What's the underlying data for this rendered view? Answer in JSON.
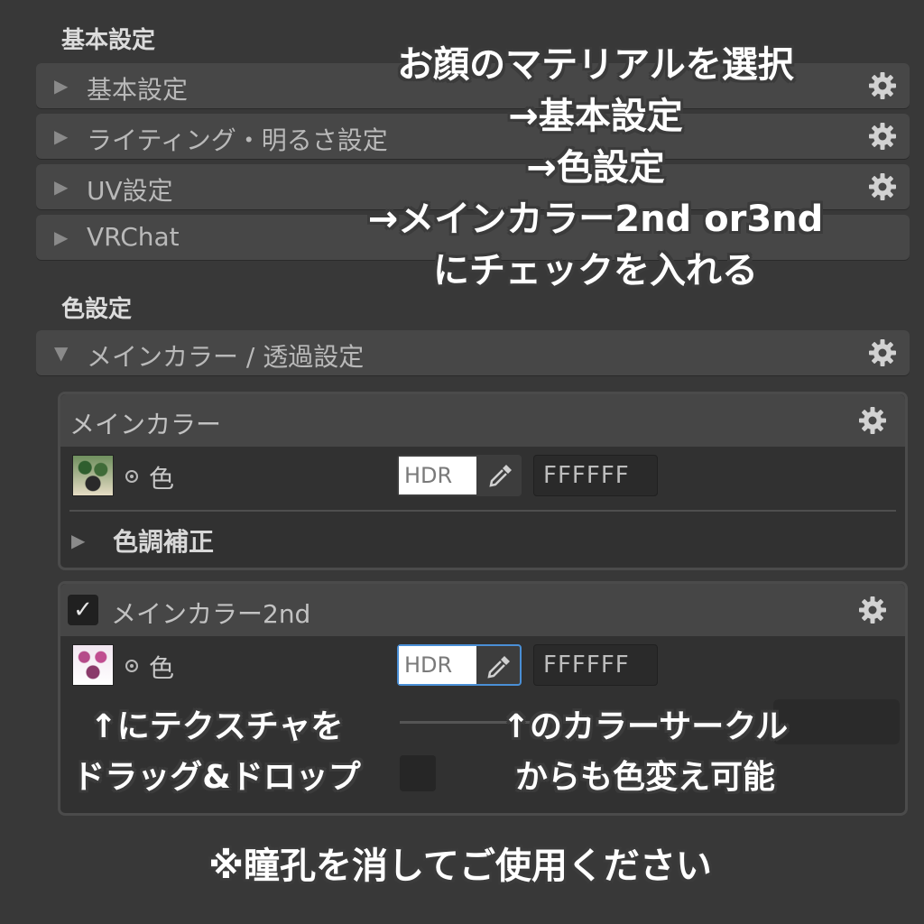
{
  "panel": {
    "basic_section_title": "基本設定",
    "foldouts": [
      {
        "label": "基本設定"
      },
      {
        "label": "ライティング・明るさ設定"
      },
      {
        "label": "UV設定"
      },
      {
        "label": "VRChat"
      }
    ],
    "color_section_title": "色設定",
    "main_color_foldout": {
      "label": "メインカラー / 透過設定"
    },
    "main_color_box": {
      "header": "メインカラー",
      "color_label": "色",
      "hdr_label": "HDR",
      "hex_value": "FFFFFF",
      "tone_correction_label": "色調補正"
    },
    "main_color_2nd_box": {
      "header": "メインカラー2nd",
      "checked_mark": "✓",
      "color_label": "色",
      "hdr_label": "HDR",
      "hex_value": "FFFFFF"
    }
  },
  "annotations": {
    "top_instruction": [
      "お顔のマテリアルを選択",
      "→基本設定",
      "→色設定",
      "→メインカラー2nd or3nd",
      "にチェックを入れる"
    ],
    "texture_hint": [
      "↑にテクスチャを",
      "ドラッグ&ドロップ"
    ],
    "color_circle_hint": [
      "↑のカラーサークル",
      "からも色変え可能"
    ],
    "footer_note": "※瞳孔を消してご使用ください"
  }
}
